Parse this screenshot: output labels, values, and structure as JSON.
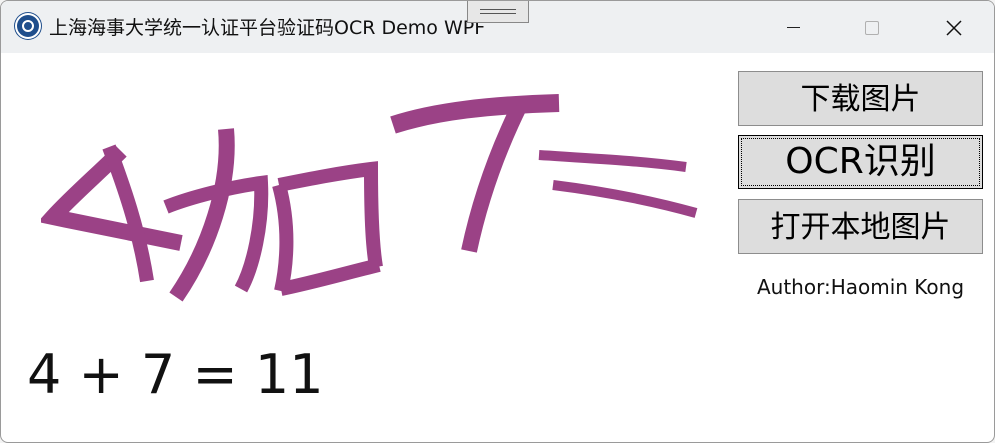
{
  "window": {
    "title": "上海海事大学统一认证平台验证码OCR Demo WPF",
    "icon": "university-seal-icon",
    "controls": [
      "minimize-icon",
      "maximize-icon",
      "close-icon"
    ]
  },
  "captcha": {
    "glyph_color": "#9b4286"
  },
  "buttons": {
    "download": "下载图片",
    "ocr": "OCR识别",
    "open_local": "打开本地图片"
  },
  "author": "Author:Haomin Kong",
  "result": "4 + 7 = 11"
}
